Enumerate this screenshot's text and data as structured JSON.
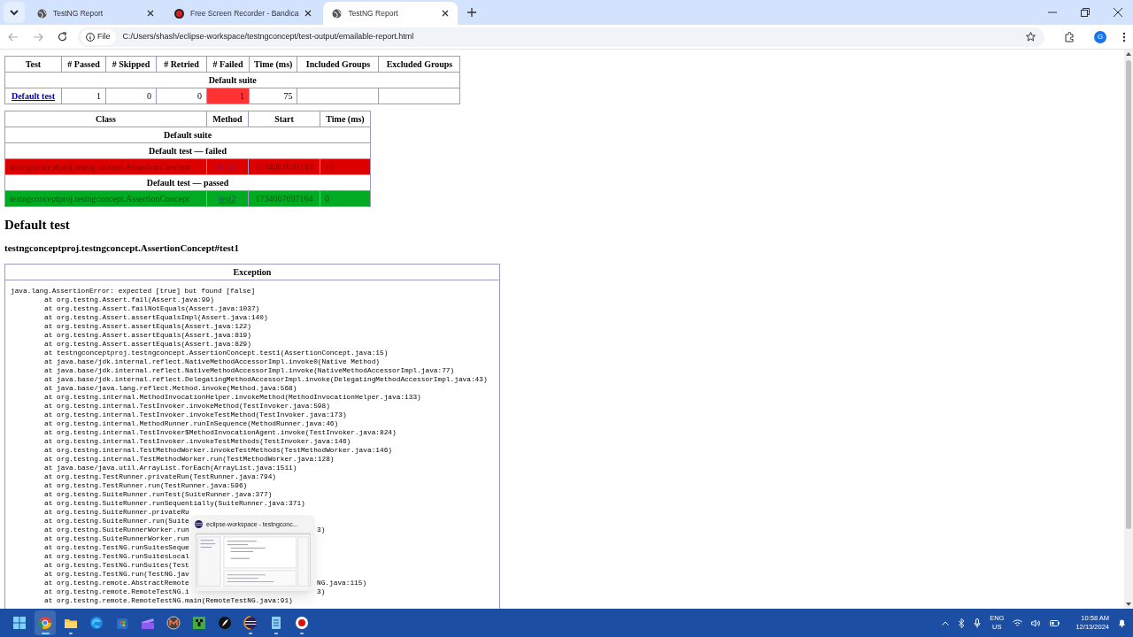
{
  "browser": {
    "tabs": [
      {
        "title": "TestNG Report",
        "kind": "site",
        "selected": false
      },
      {
        "title": "Free Screen Recorder - Bandica",
        "kind": "recorder",
        "selected": false
      },
      {
        "title": "TestNG Report",
        "kind": "site",
        "selected": true
      }
    ],
    "address": {
      "scheme": "File",
      "url": "C:/Users/shash/eclipse-workspace/testngconcept/test-output/emailable-report.html"
    },
    "profile_initial": "G"
  },
  "summary_table": {
    "columns": [
      "Test",
      "# Passed",
      "# Skipped",
      "# Retried",
      "# Failed",
      "Time (ms)",
      "Included Groups",
      "Excluded Groups"
    ],
    "suite": "Default suite",
    "rows": [
      {
        "test": "Default test",
        "passed": "1",
        "skipped": "0",
        "retried": "0",
        "failed": "1",
        "failed_highlight": true,
        "time": "75"
      }
    ]
  },
  "methods_table": {
    "columns": [
      "Class",
      "Method",
      "Start",
      "Time (ms)"
    ],
    "suite": "Default suite",
    "groups": [
      {
        "heading": "Default test — failed",
        "kind": "failed",
        "rows": [
          {
            "class": "testngconceptproj.testngconcept.AssertionConcept",
            "method": "test1",
            "start": "1734067697143",
            "time": "15"
          }
        ]
      },
      {
        "heading": "Default test — passed",
        "kind": "passed",
        "rows": [
          {
            "class": "testngconceptproj.testngconcept.AssertionConcept",
            "method": "test2",
            "start": "1734067697164",
            "time": "0"
          }
        ]
      }
    ]
  },
  "test_heading": "Default test",
  "method_heading": "testngconceptproj.testngconcept.AssertionConcept#test1",
  "exception": {
    "heading": "Exception",
    "lines": [
      {
        "text": "java.lang.AssertionError: expected [true] but found [false]",
        "kind": "message"
      },
      {
        "text": "at org.testng.Assert.fail(Assert.java:99)",
        "kind": "frame"
      },
      {
        "text": "at org.testng.Assert.failNotEquals(Assert.java:1037)",
        "kind": "frame"
      },
      {
        "text": "at org.testng.Assert.assertEqualsImpl(Assert.java:140)",
        "kind": "frame"
      },
      {
        "text": "at org.testng.Assert.assertEquals(Assert.java:122)",
        "kind": "frame"
      },
      {
        "text": "at org.testng.Assert.assertEquals(Assert.java:819)",
        "kind": "frame"
      },
      {
        "text": "at org.testng.Assert.assertEquals(Assert.java:829)",
        "kind": "frame"
      },
      {
        "text": "at testngconceptproj.testngconcept.AssertionConcept.test1(AssertionConcept.java:15)",
        "kind": "frame"
      },
      {
        "text": "at java.base/jdk.internal.reflect.NativeMethodAccessorImpl.invoke0(Native Method)",
        "kind": "frame"
      },
      {
        "text": "at java.base/jdk.internal.reflect.NativeMethodAccessorImpl.invoke(NativeMethodAccessorImpl.java:77)",
        "kind": "frame"
      },
      {
        "text": "at java.base/jdk.internal.reflect.DelegatingMethodAccessorImpl.invoke(DelegatingMethodAccessorImpl.java:43)",
        "kind": "frame"
      },
      {
        "text": "at java.base/java.lang.reflect.Method.invoke(Method.java:568)",
        "kind": "frame"
      },
      {
        "text": "at org.testng.internal.MethodInvocationHelper.invokeMethod(MethodInvocationHelper.java:133)",
        "kind": "frame"
      },
      {
        "text": "at org.testng.internal.TestInvoker.invokeMethod(TestInvoker.java:598)",
        "kind": "frame"
      },
      {
        "text": "at org.testng.internal.TestInvoker.invokeTestMethod(TestInvoker.java:173)",
        "kind": "frame"
      },
      {
        "text": "at org.testng.internal.MethodRunner.runInSequence(MethodRunner.java:46)",
        "kind": "frame"
      },
      {
        "text": "at org.testng.internal.TestInvoker$MethodInvocationAgent.invoke(TestInvoker.java:824)",
        "kind": "frame"
      },
      {
        "text": "at org.testng.internal.TestInvoker.invokeTestMethods(TestInvoker.java:146)",
        "kind": "frame"
      },
      {
        "text": "at org.testng.internal.TestMethodWorker.invokeTestMethods(TestMethodWorker.java:146)",
        "kind": "frame"
      },
      {
        "text": "at org.testng.internal.TestMethodWorker.run(TestMethodWorker.java:128)",
        "kind": "frame"
      },
      {
        "text": "at java.base/java.util.ArrayList.forEach(ArrayList.java:1511)",
        "kind": "frame"
      },
      {
        "text": "at org.testng.TestRunner.privateRun(TestRunner.java:794)",
        "kind": "frame"
      },
      {
        "text": "at org.testng.TestRunner.run(TestRunner.java:596)",
        "kind": "frame"
      },
      {
        "text": "at org.testng.SuiteRunner.runTest(SuiteRunner.java:377)",
        "kind": "frame"
      },
      {
        "text": "at org.testng.SuiteRunner.runSequentially(SuiteRunner.java:371)",
        "kind": "frame"
      },
      {
        "text": "at org.testng.SuiteRunner.privateRu",
        "kind": "frame"
      },
      {
        "text": "at org.testng.SuiteRunner.run(Suite",
        "kind": "frame"
      },
      {
        "text": "at org.testng.SuiteRunnerWorker.run",
        "tail": "3)",
        "kind": "frame"
      },
      {
        "text": "at org.testng.SuiteRunnerWorker.run",
        "kind": "frame"
      },
      {
        "text": "at org.testng.TestNG.runSuitesSeque",
        "kind": "frame"
      },
      {
        "text": "at org.testng.TestNG.runSuitesLocal",
        "kind": "frame"
      },
      {
        "text": "at org.testng.TestNG.runSuites(Test",
        "kind": "frame"
      },
      {
        "text": "at org.testng.TestNG.run(TestNG.jav",
        "kind": "frame"
      },
      {
        "text": "at org.testng.remote.AbstractRemote",
        "tail": "NG.java:115)",
        "kind": "frame"
      },
      {
        "text": "at org.testng.remote.RemoteTestNG.i",
        "tail": "3)",
        "kind": "frame"
      },
      {
        "text": "at org.testng.remote.RemoteTestNG.main(RemoteTestNG.java:91)",
        "kind": "frame"
      }
    ]
  },
  "taskbar_preview": {
    "title": "eclipse-workspace - testngconc..."
  },
  "taskbar": {
    "apps": [
      {
        "kind": "start",
        "running": false,
        "active": false
      },
      {
        "kind": "chrome",
        "running": true,
        "active": true
      },
      {
        "kind": "folder",
        "running": true,
        "active": false
      },
      {
        "kind": "edge",
        "running": false,
        "active": false
      },
      {
        "kind": "store",
        "running": false,
        "active": false
      },
      {
        "kind": "clapper",
        "running": false,
        "active": false
      },
      {
        "kind": "m-app",
        "running": false,
        "active": false
      },
      {
        "kind": "creeper",
        "running": false,
        "active": false
      },
      {
        "kind": "quill",
        "running": false,
        "active": false
      },
      {
        "kind": "eclipse",
        "running": true,
        "active": false
      },
      {
        "kind": "notepad",
        "running": true,
        "active": false
      },
      {
        "kind": "record",
        "running": true,
        "active": false
      }
    ],
    "language": "ENG",
    "region": "US",
    "time": "10:58 AM",
    "date": "12/13/2024"
  }
}
